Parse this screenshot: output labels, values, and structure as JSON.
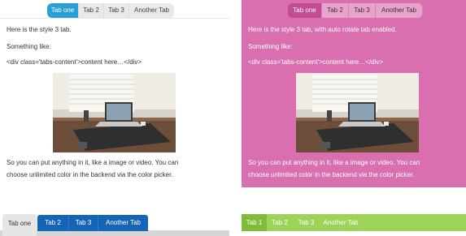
{
  "left": {
    "tabs": [
      "Tab one",
      "Tab 2",
      "Tab 3",
      "Another Tab"
    ],
    "text": {
      "line1": "Here is the style 3 tab.",
      "line2": "Something like:",
      "line3": "<div class='tabs-content'>content here…</div>",
      "line4": "So you can put anything in it, like a image or video. You can",
      "line5": "choose unlimited color in the backend via the color picker."
    }
  },
  "right": {
    "tabs": [
      "Tab one",
      "Tab 2",
      "Tab 3",
      "Another Tab"
    ],
    "text": {
      "line1": "Here is the style 3 tab, with auto rotate tab enabled.",
      "line2": "Something like:",
      "line3": "<div class='tabs-content'>content here…</div>",
      "line4": "So you can put anything in it, like a image or video. You can",
      "line5": "choose unlimited color in the backend via the color picker."
    }
  },
  "bottom_left_tabs": [
    "Tab one",
    "Tab 2",
    "Tab 3",
    "Another Tab"
  ],
  "bottom_right_tabs": [
    "Tab 1",
    "Tab 2",
    "Tab 3",
    "Another Tab"
  ],
  "colors": {
    "blue_active": "#2a9fd6",
    "pink_panel": "#d96fae",
    "pink_active": "#c24b92",
    "dark_blue": "#1565b6",
    "green": "#9ed35a",
    "green_active": "#80bb3a"
  },
  "icons": {
    "photo": "desk-laptop-photo"
  }
}
